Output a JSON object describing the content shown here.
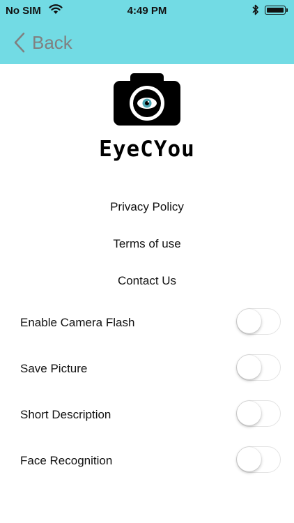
{
  "status_bar": {
    "carrier": "No SIM",
    "time": "4:49 PM"
  },
  "nav": {
    "back_label": "Back"
  },
  "brand": {
    "name": "EyeCYou"
  },
  "links": {
    "privacy": "Privacy Policy",
    "terms": "Terms of use",
    "contact": "Contact Us"
  },
  "settings": {
    "flash": {
      "label": "Enable Camera Flash",
      "enabled": false
    },
    "save_picture": {
      "label": "Save Picture",
      "enabled": false
    },
    "short_description": {
      "label": "Short Description",
      "enabled": false
    },
    "face_recognition": {
      "label": "Face Recognition",
      "enabled": false
    }
  },
  "colors": {
    "header_background": "#72dbe4",
    "back_text": "#808080"
  },
  "icons": {
    "wifi": "wifi-icon",
    "bluetooth": "bluetooth-icon",
    "battery": "battery-icon",
    "back": "chevron-left-icon",
    "logo": "camera-logo-icon"
  }
}
